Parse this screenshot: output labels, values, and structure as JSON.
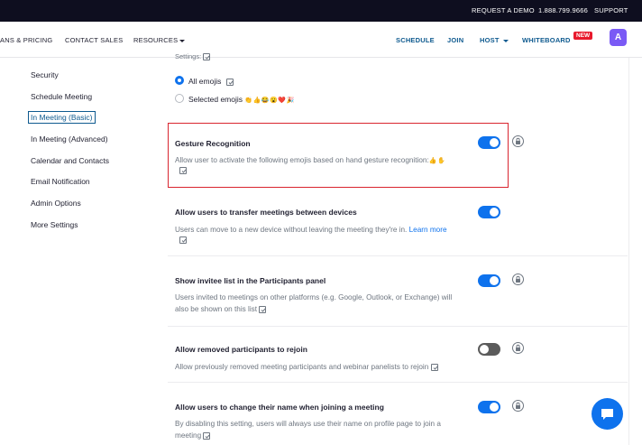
{
  "topbar": {
    "request_demo": "REQUEST A DEMO",
    "phone": "1.888.799.9666",
    "support": "SUPPORT"
  },
  "nav": {
    "plans": "ANS & PRICING",
    "contact_sales": "CONTACT SALES",
    "resources": "RESOURCES",
    "schedule": "SCHEDULE",
    "join": "JOIN",
    "host": "HOST",
    "whiteboard": "WHITEBOARD",
    "new_badge": "NEW",
    "avatar_letter": "A"
  },
  "sidebar": {
    "items": [
      {
        "label": "Security"
      },
      {
        "label": "Schedule Meeting"
      },
      {
        "label": "In Meeting (Basic)",
        "active": true
      },
      {
        "label": "In Meeting (Advanced)"
      },
      {
        "label": "Calendar and Contacts"
      },
      {
        "label": "Email Notification"
      },
      {
        "label": "Admin Options"
      },
      {
        "label": "More Settings"
      }
    ]
  },
  "emoji_section": {
    "settings_label": "Settings:",
    "all_emojis": "All emojis",
    "selected_emojis": "Selected emojis",
    "selected_emoji_glyphs": "👏👍😂😮❤️🎉",
    "selected_option": "All emojis"
  },
  "settings": [
    {
      "title": "Gesture Recognition",
      "desc": "Allow user to activate the following emojis based on hand gesture recognition:",
      "desc_emojis": "👍✋",
      "enabled": true,
      "locked": true
    },
    {
      "title": "Allow users to transfer meetings between devices",
      "desc": "Users can move to a new device without leaving the meeting they're in.",
      "link": "Learn more",
      "enabled": true,
      "locked": false
    },
    {
      "title": "Show invitee list in the Participants panel",
      "desc_line1": "Users invited to meetings on other platforms (e.g. Google, Outlook, or Exchange) will",
      "desc_line2": "also be shown on this list",
      "enabled": true,
      "locked": true
    },
    {
      "title": "Allow removed participants to rejoin",
      "desc": "Allow previously removed meeting participants and webinar panelists to rejoin",
      "enabled": false,
      "locked": true
    },
    {
      "title": "Allow users to change their name when joining a meeting",
      "desc_line1": "By disabling this setting, users will always use their name on profile page to join a",
      "desc_line2": "meeting",
      "enabled": true,
      "locked": true
    }
  ],
  "colors": {
    "accent": "#0e72ed",
    "nav_blue": "#0e5a8f",
    "highlight": "#d9252f",
    "topbar": "#0e0e1f",
    "avatar": "#7a5af5"
  },
  "icons": [
    "info-icon",
    "lock-icon",
    "chat-icon",
    "chevron-down-icon"
  ]
}
